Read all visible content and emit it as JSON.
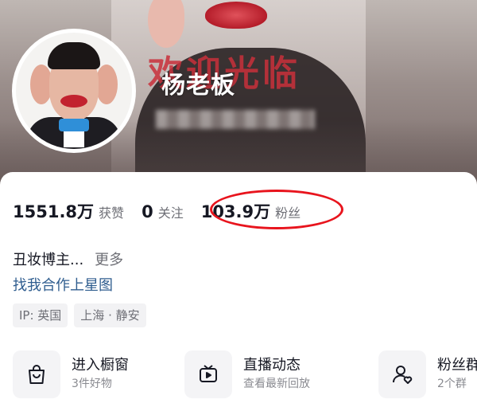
{
  "banner": {
    "sign_text": "欢迎光临",
    "colors": {
      "top": "#bfb7b3",
      "bottom": "#7a6b69",
      "sign": "#c9303b"
    }
  },
  "profile": {
    "nickname": "杨老板"
  },
  "stats": [
    {
      "value": "1551.8万",
      "label": "获赞"
    },
    {
      "value": "0",
      "label": "关注"
    },
    {
      "value": "103.9万",
      "label": "粉丝"
    }
  ],
  "highlight_color": "#e8141d",
  "bio": {
    "text": "丑妆博主...",
    "more_label": "更多",
    "cooperate_link": "找我合作上星图",
    "link_color": "#2f5d8f"
  },
  "tags": [
    "IP: 英国",
    "上海 · 静安"
  ],
  "features": [
    {
      "icon": "shopping-bag-icon",
      "title": "进入橱窗",
      "subtitle": "3件好物"
    },
    {
      "icon": "live-tv-icon",
      "title": "直播动态",
      "subtitle": "查看最新回放"
    },
    {
      "icon": "fan-group-icon",
      "title": "粉丝群",
      "subtitle": "2个群"
    }
  ]
}
